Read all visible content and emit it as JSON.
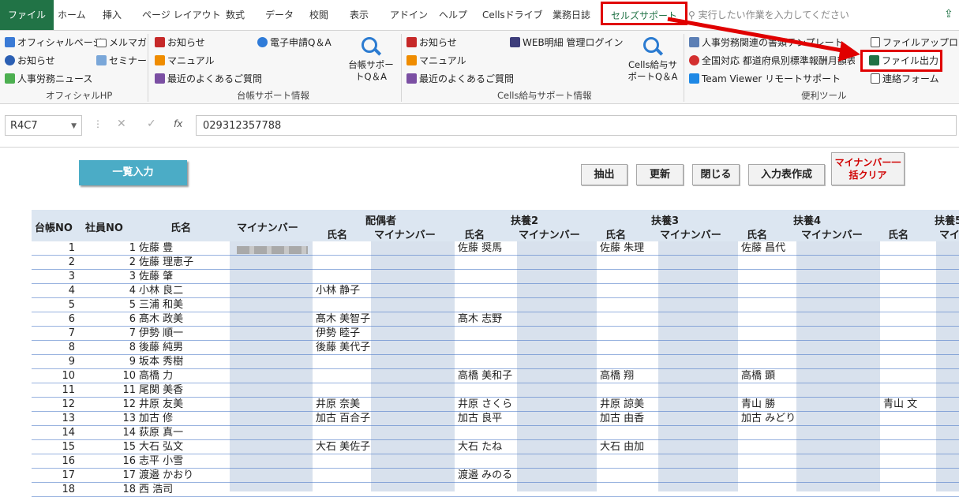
{
  "tabs": [
    "ファイル",
    "ホーム",
    "挿入",
    "ページ レイアウト",
    "数式",
    "データ",
    "校閲",
    "表示",
    "アドイン",
    "ヘルプ",
    "Cellsドライブ",
    "業務日誌",
    "セルズサポート"
  ],
  "tell_me": "実行したい作業を入力してください",
  "ribbon": {
    "official": [
      "オフィシャルページ",
      "お知らせ",
      "人事労務ニュース"
    ],
    "official2": [
      "メルマガ",
      "セミナー"
    ],
    "official_group": "オフィシャルHP",
    "daicho": [
      "お知らせ",
      "マニュアル",
      "最近のよくあるご質問"
    ],
    "denshi": "電子申請Q＆A",
    "daicho_qa": "台帳サポートQ＆A",
    "daicho_group": "台帳サポート情報",
    "cells": [
      "お知らせ",
      "マニュアル",
      "最近のよくあるご質問"
    ],
    "web": "WEB明細 管理ログイン",
    "cells_qa": "Cells給与サポートQ＆A",
    "cells_group": "Cells給与サポート情報",
    "tools": [
      "人事労務関連の書類テンプレート",
      "全国対応 都道府県別標準報酬月額表",
      "Team Viewer リモートサポート"
    ],
    "tools2": [
      "ファイルアップロード",
      "ファイル出力",
      "連絡フォーム"
    ],
    "tools_group": "便利ツール"
  },
  "namebox": "R4C7",
  "formula": "029312357788",
  "buttons": {
    "list": "一覧入力",
    "extract": "抽出",
    "update": "更新",
    "close": "閉じる",
    "create": "入力表作成",
    "clear": "マイナンバー一括クリア"
  },
  "headers": {
    "daicho": "台帳NO",
    "emp": "社員NO",
    "name": "氏名",
    "mynum": "マイナンバー",
    "spouse": "配偶者",
    "fuyo2": "扶養2",
    "fuyo3": "扶養3",
    "fuyo4": "扶養4",
    "fuyo5": "扶養5",
    "sub_name": "氏名",
    "sub_mynum": "マイナンバー"
  },
  "rows": [
    {
      "no": "1",
      "emp": "1",
      "name": "佐藤 豊",
      "sp": "",
      "f2": "佐藤 奨馬",
      "f3": "佐藤 朱理",
      "f4": "佐藤 昌代",
      "f5": ""
    },
    {
      "no": "2",
      "emp": "2",
      "name": "佐藤 理恵子",
      "sp": "",
      "f2": "",
      "f3": "",
      "f4": "",
      "f5": ""
    },
    {
      "no": "3",
      "emp": "3",
      "name": "佐藤 肇",
      "sp": "",
      "f2": "",
      "f3": "",
      "f4": "",
      "f5": ""
    },
    {
      "no": "4",
      "emp": "4",
      "name": "小林 良二",
      "sp": "小林 静子",
      "f2": "",
      "f3": "",
      "f4": "",
      "f5": ""
    },
    {
      "no": "5",
      "emp": "5",
      "name": "三浦 和美",
      "sp": "",
      "f2": "",
      "f3": "",
      "f4": "",
      "f5": ""
    },
    {
      "no": "6",
      "emp": "6",
      "name": "髙木 政美",
      "sp": "髙木 美智子",
      "f2": "髙木 志野",
      "f3": "",
      "f4": "",
      "f5": ""
    },
    {
      "no": "7",
      "emp": "7",
      "name": "伊勢 順一",
      "sp": "伊勢 睦子",
      "f2": "",
      "f3": "",
      "f4": "",
      "f5": ""
    },
    {
      "no": "8",
      "emp": "8",
      "name": "後藤 純男",
      "sp": "後藤 美代子",
      "f2": "",
      "f3": "",
      "f4": "",
      "f5": ""
    },
    {
      "no": "9",
      "emp": "9",
      "name": "坂本 秀樹",
      "sp": "",
      "f2": "",
      "f3": "",
      "f4": "",
      "f5": ""
    },
    {
      "no": "10",
      "emp": "10",
      "name": "高橋 力",
      "sp": "",
      "f2": "高橋 美和子",
      "f3": "高橋 翔",
      "f4": "高橋 顕",
      "f5": ""
    },
    {
      "no": "11",
      "emp": "11",
      "name": "尾関 美香",
      "sp": "",
      "f2": "",
      "f3": "",
      "f4": "",
      "f5": ""
    },
    {
      "no": "12",
      "emp": "12",
      "name": "井原 友美",
      "sp": "井原 奈美",
      "f2": "井原 さくら",
      "f3": "井原 諒美",
      "f4": "青山 勝",
      "f5": "青山 文"
    },
    {
      "no": "13",
      "emp": "13",
      "name": "加古 修",
      "sp": "加古 百合子",
      "f2": "加古 良平",
      "f3": "加古 由香",
      "f4": "加古 みどり",
      "f5": ""
    },
    {
      "no": "14",
      "emp": "14",
      "name": "荻原 真一",
      "sp": "",
      "f2": "",
      "f3": "",
      "f4": "",
      "f5": ""
    },
    {
      "no": "15",
      "emp": "15",
      "name": "大石 弘文",
      "sp": "大石 美佐子",
      "f2": "大石 たね",
      "f3": "大石 由加",
      "f4": "",
      "f5": ""
    },
    {
      "no": "16",
      "emp": "16",
      "name": "志平 小雪",
      "sp": "",
      "f2": "",
      "f3": "",
      "f4": "",
      "f5": ""
    },
    {
      "no": "17",
      "emp": "17",
      "name": "渡邉 かおり",
      "sp": "",
      "f2": "渡邉 みのる",
      "f3": "",
      "f4": "",
      "f5": ""
    },
    {
      "no": "18",
      "emp": "18",
      "name": "西 浩司",
      "sp": "",
      "f2": "",
      "f3": "",
      "f4": "",
      "f5": ""
    }
  ],
  "colors": {
    "accent": "#217346",
    "highlight": "#e00000",
    "band": "#d8e1ed",
    "header": "#dce6f1"
  }
}
